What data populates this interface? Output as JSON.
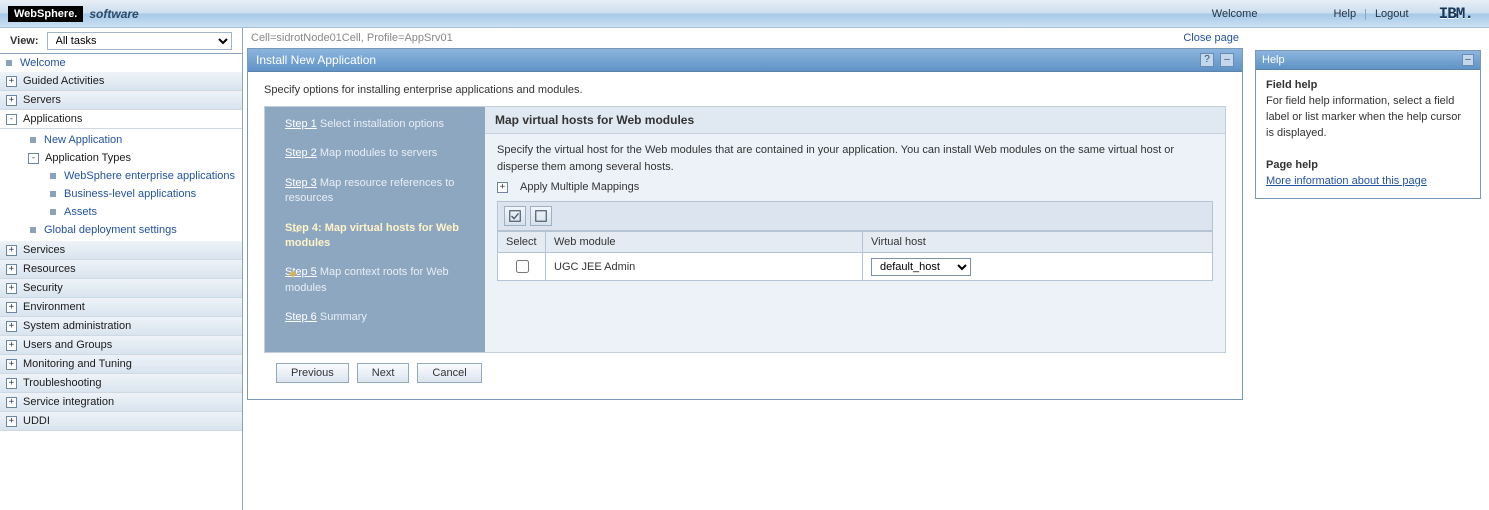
{
  "topbar": {
    "brand": "WebSphere.",
    "software": "software",
    "welcome": "Welcome",
    "help": "Help",
    "logout": "Logout",
    "ibm": "IBM."
  },
  "viewrow": {
    "label": "View:",
    "selected": "All tasks"
  },
  "nav": {
    "welcome": "Welcome",
    "guided": "Guided Activities",
    "servers": "Servers",
    "applications": "Applications",
    "new_app": "New Application",
    "app_types": "Application Types",
    "ws_apps": "WebSphere enterprise applications",
    "biz_apps": "Business-level applications",
    "assets": "Assets",
    "global_dep": "Global deployment settings",
    "services": "Services",
    "resources": "Resources",
    "security": "Security",
    "environment": "Environment",
    "sysadmin": "System administration",
    "users_groups": "Users and Groups",
    "monitoring": "Monitoring and Tuning",
    "troubleshoot": "Troubleshooting",
    "svc_integ": "Service integration",
    "uddi": "UDDI"
  },
  "breadcrumb": "Cell=sidrotNode01Cell, Profile=AppSrv01",
  "close_page": "Close page",
  "panel": {
    "title": "Install New Application",
    "intro": "Specify options for installing enterprise applications and modules."
  },
  "steps": {
    "s1_link": "Step 1",
    "s1_text": "Select installation options",
    "s2_link": "Step 2",
    "s2_text": "Map modules to servers",
    "s3_link": "Step 3",
    "s3_text": "Map resource references to resources",
    "s4_bold": "Step 4: Map virtual hosts for Web modules",
    "s5_link": "Step 5",
    "s5_text": "Map context roots for Web modules",
    "s6_link": "Step 6",
    "s6_text": "Summary"
  },
  "form": {
    "title": "Map virtual hosts for Web modules",
    "desc": "Specify the virtual host for the Web modules that are contained in your application. You can install Web modules on the same virtual host or disperse them among several hosts.",
    "apply_mm": "Apply Multiple Mappings",
    "table": {
      "col_select": "Select",
      "col_web": "Web module",
      "col_vhost": "Virtual host",
      "rows": [
        {
          "module": "UGC JEE Admin",
          "vhost": "default_host"
        }
      ]
    }
  },
  "buttons": {
    "prev": "Previous",
    "next": "Next",
    "cancel": "Cancel"
  },
  "help": {
    "title": "Help",
    "field_help_h": "Field help",
    "field_help_t": "For field help information, select a field label or list marker when the help cursor is displayed.",
    "page_help_h": "Page help",
    "page_help_link": "More information about this page"
  }
}
